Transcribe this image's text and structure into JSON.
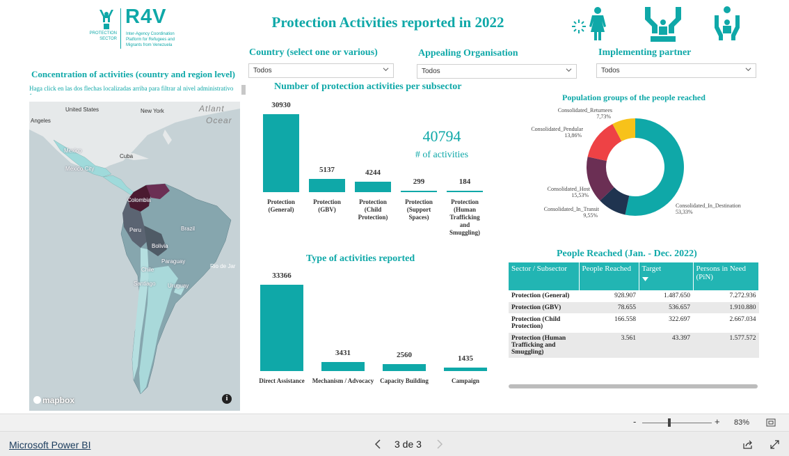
{
  "header": {
    "logo_sector": [
      "PROTECTION",
      "SECTOR"
    ],
    "logo_r4v": "R4V",
    "logo_desc": [
      "Inter-Agency Coordination",
      "Platform for Refugees and",
      "Migrants from Venezuela"
    ],
    "title": "Protection Activities reported in 2022"
  },
  "filters": [
    {
      "label": "Country (select one or various)",
      "value": "Todos"
    },
    {
      "label": "Appealing Organisation",
      "value": "Todos"
    },
    {
      "label": "Implementing partner",
      "value": "Todos"
    }
  ],
  "map": {
    "title": "Concentration of activities (country and region level)",
    "hint": "Haga click en las dos flechas localizadas arriba para filtrar al nivel administrativo 1",
    "labels": [
      "United States",
      "New York",
      "Atlant",
      "Ocear",
      "Angeles",
      "Mexico",
      "Cuba",
      "Mexico City",
      "Colombia",
      "Peru",
      "Brazil",
      "Bolivia",
      "Paraguay",
      "Chile",
      "Santiago",
      "Uruguay",
      "Rio de Jar"
    ],
    "attribution": "mapbox",
    "info_icon": "info-icon"
  },
  "kpi": {
    "value": "40794",
    "label": "# of activities"
  },
  "subsector_chart": {
    "title": "Number of protection activities per subsector"
  },
  "type_chart": {
    "title": "Type of activities reported"
  },
  "donut": {
    "title": "Population groups of the people reached",
    "colors": [
      "#0fa8a8",
      "#1f3450",
      "#6b2f54",
      "#ee4245",
      "#f7c21a"
    ]
  },
  "people_table": {
    "title": "People Reached (Jan. - Dec. 2022)",
    "columns": [
      "Sector / Subsector",
      "People Reached",
      "Target",
      "Persons in Need (PiN)"
    ],
    "rows": [
      [
        "Protection (General)",
        "928.907",
        "1.487.650",
        "7.272.936"
      ],
      [
        "Protection (GBV)",
        "78.655",
        "536.657",
        "1.910.880"
      ],
      [
        "Protection (Child Protection)",
        "166.558",
        "322.697",
        "2.667.034"
      ],
      [
        "Protection (Human Trafficking and Smuggling)",
        "3.561",
        "43.397",
        "1.577.572"
      ]
    ]
  },
  "zoom": {
    "minus": "-",
    "plus": "+",
    "level": "83%"
  },
  "footer": {
    "brand": "Microsoft Power BI",
    "page": "3 de 3"
  },
  "chart_data": [
    {
      "type": "bar",
      "title": "Number of protection activities per subsector",
      "categories": [
        "Protection (General)",
        "Protection (GBV)",
        "Protection (Child Protection)",
        "Protection (Support Spaces)",
        "Protection (Human Trafficking and Smuggling)"
      ],
      "values": [
        30930,
        5137,
        4244,
        299,
        184
      ]
    },
    {
      "type": "bar",
      "title": "Type of activities reported",
      "categories": [
        "Direct Assistance",
        "Mechanism / Advocacy",
        "Capacity Building",
        "Campaign"
      ],
      "values": [
        33366,
        3431,
        2560,
        1435
      ]
    },
    {
      "type": "pie",
      "title": "Population groups of the people reached",
      "categories": [
        "Consolidated_In_Destination",
        "Consolidated_In_Transit",
        "Consolidated_Host",
        "Consolidated_Pendular",
        "Consolidated_Returnees"
      ],
      "values": [
        53.33,
        9.55,
        15.53,
        13.86,
        7.73
      ],
      "value_labels": [
        "53,33%",
        "9,55%",
        "15,53%",
        "13,86%",
        "7,73%"
      ]
    }
  ]
}
